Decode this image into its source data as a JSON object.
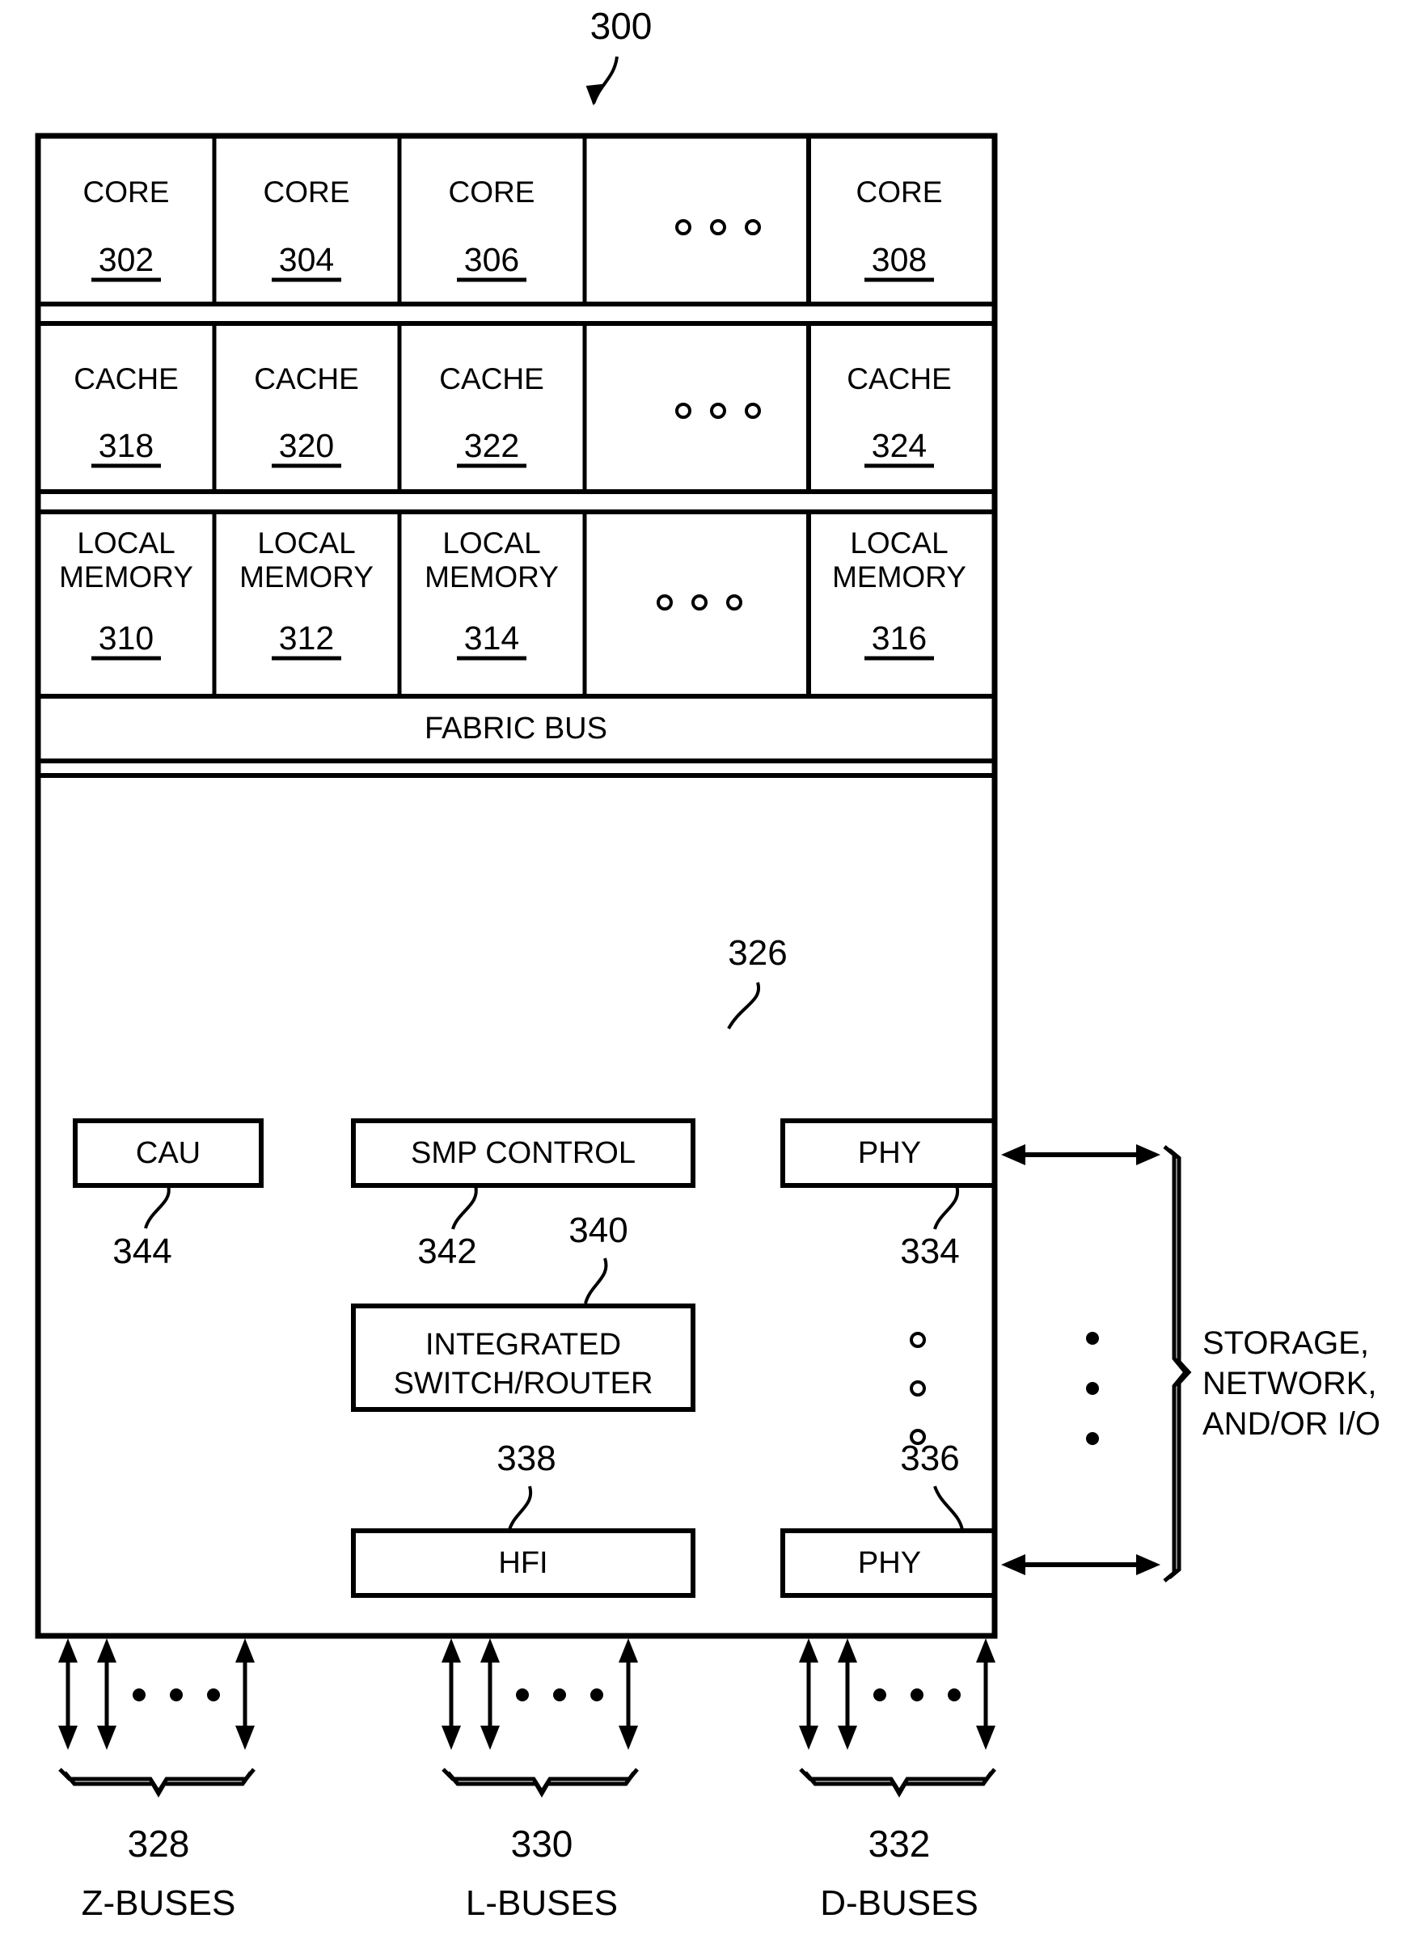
{
  "figure": {
    "reference_numeral": "300",
    "title_label": "300"
  },
  "chip": {
    "core_row": {
      "label": "CORE",
      "cells": [
        {
          "label": "CORE",
          "number": "302"
        },
        {
          "label": "CORE",
          "number": "304"
        },
        {
          "label": "CORE",
          "number": "306"
        },
        {
          "label": "CORE",
          "number": "308"
        }
      ],
      "ellipsis": "o o o"
    },
    "cache_row": {
      "label": "CACHE",
      "cells": [
        {
          "label": "CACHE",
          "number": "318"
        },
        {
          "label": "CACHE",
          "number": "320"
        },
        {
          "label": "CACHE",
          "number": "322"
        },
        {
          "label": "CACHE",
          "number": "324"
        }
      ],
      "ellipsis": "o o o"
    },
    "local_memory_row": {
      "label_line1": "LOCAL",
      "label_line2": "MEMORY",
      "cells": [
        {
          "line1": "LOCAL",
          "line2": "MEMORY",
          "number": "310"
        },
        {
          "line1": "LOCAL",
          "line2": "MEMORY",
          "number": "312"
        },
        {
          "line1": "LOCAL",
          "line2": "MEMORY",
          "number": "314"
        },
        {
          "line1": "LOCAL",
          "line2": "MEMORY",
          "number": "316"
        }
      ],
      "ellipsis": "o o o"
    },
    "fabric_bus": {
      "label": "FABRIC BUS",
      "number": "326"
    },
    "lower_blocks": {
      "cau": {
        "label": "CAU",
        "number": "344"
      },
      "smp_control": {
        "label": "SMP CONTROL",
        "number": "342"
      },
      "integrated_switch_router": {
        "line1": "INTEGRATED",
        "line2": "SWITCH/ROUTER",
        "number": "340"
      },
      "hfi": {
        "label": "HFI",
        "number": "338"
      },
      "phy_top": {
        "label": "PHY",
        "number": "334"
      },
      "phy_bottom": {
        "label": "PHY",
        "number": "336"
      }
    }
  },
  "external": {
    "brace_label_line1": "STORAGE,",
    "brace_label_line2": "NETWORK,",
    "brace_label_line3": "AND/OR I/O"
  },
  "buses": [
    {
      "number": "328",
      "name": "Z-BUSES"
    },
    {
      "number": "330",
      "name": "L-BUSES"
    },
    {
      "number": "332",
      "name": "D-BUSES"
    }
  ],
  "colors": {
    "ink": "#000000",
    "paper": "#ffffff"
  }
}
